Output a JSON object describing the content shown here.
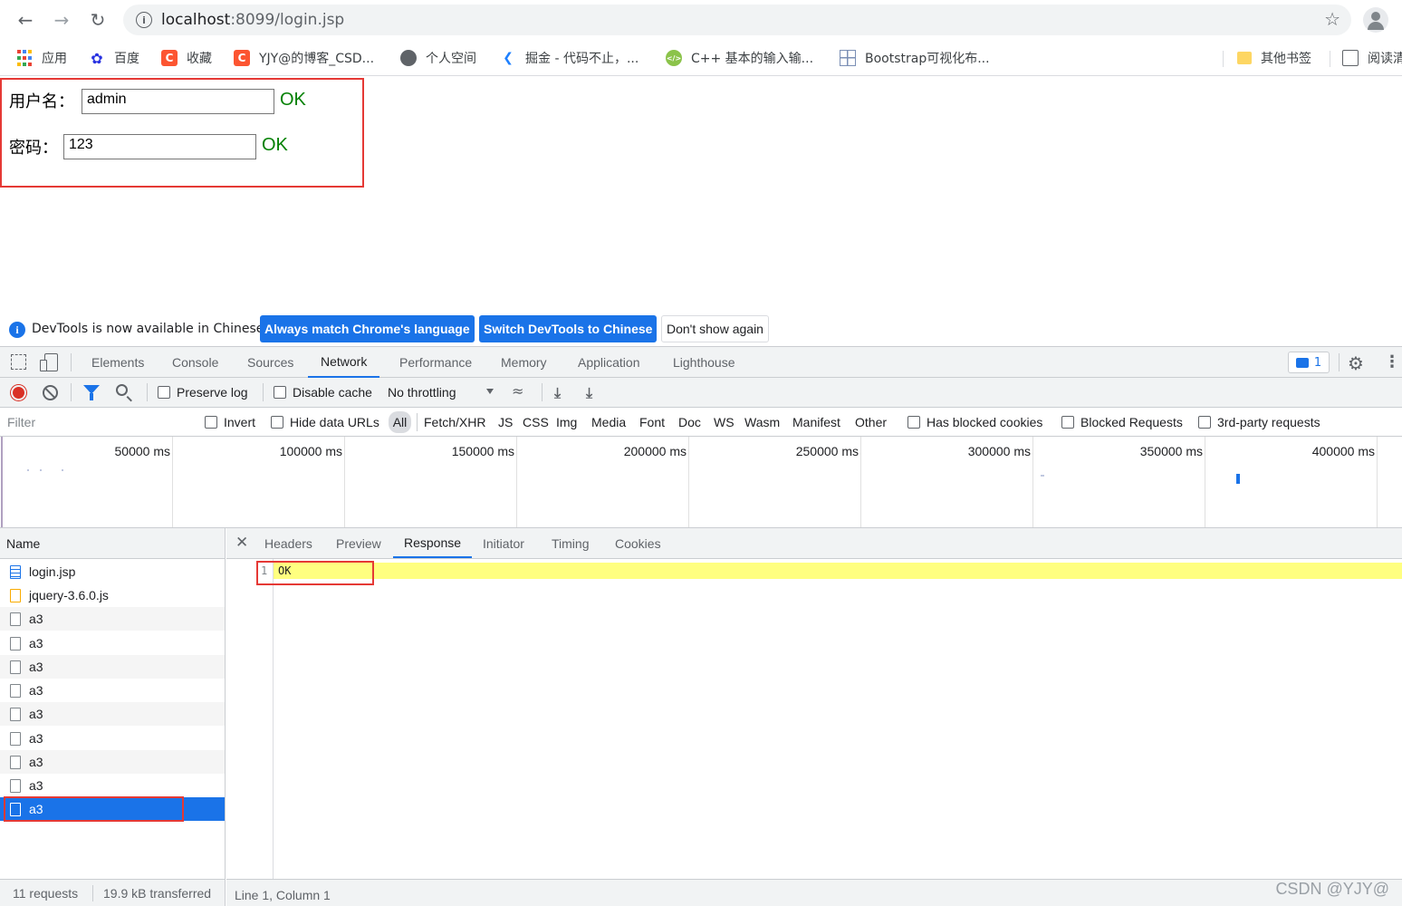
{
  "browser": {
    "url_host": "localhost",
    "url_rest": ":8099/login.jsp",
    "bookmarks": [
      {
        "label": "应用",
        "icon": "apps-grid-icon"
      },
      {
        "label": "百度",
        "icon": "baidu-paw-icon"
      },
      {
        "label": "收藏",
        "icon": "csdn-icon"
      },
      {
        "label": "YJY@的博客_CSD...",
        "icon": "csdn-icon"
      },
      {
        "label": "个人空间",
        "icon": "globe-icon"
      },
      {
        "label": "掘金 - 代码不止，...",
        "icon": "juejin-icon"
      },
      {
        "label": "C++ 基本的输入输...",
        "icon": "cpp-icon"
      },
      {
        "label": "Bootstrap可视化布...",
        "icon": "bootstrap-grid-icon"
      },
      {
        "label": "其他书签",
        "icon": "folder-icon"
      },
      {
        "label": "阅读清",
        "icon": "reading-list-icon"
      }
    ]
  },
  "page": {
    "username_label": "用户名：",
    "username_value": "admin",
    "username_status": "OK",
    "password_label": "密码：",
    "password_value": "123",
    "password_status": "OK"
  },
  "infobar": {
    "message": "DevTools is now available in Chinese!",
    "btn_match": "Always match Chrome's language",
    "btn_switch": "Switch DevTools to Chinese",
    "btn_dismiss": "Don't show again"
  },
  "devtools": {
    "tabs": [
      "Elements",
      "Console",
      "Sources",
      "Network",
      "Performance",
      "Memory",
      "Application",
      "Lighthouse"
    ],
    "active_tab": "Network",
    "issues_count": "1",
    "toolbar": {
      "preserve_log": "Preserve log",
      "disable_cache": "Disable cache",
      "throttling": "No throttling"
    },
    "filter": {
      "placeholder": "Filter",
      "invert": "Invert",
      "hide_data_urls": "Hide data URLs",
      "types": [
        "All",
        "Fetch/XHR",
        "JS",
        "CSS",
        "Img",
        "Media",
        "Font",
        "Doc",
        "WS",
        "Wasm",
        "Manifest",
        "Other"
      ],
      "has_blocked_cookies": "Has blocked cookies",
      "blocked_requests": "Blocked Requests",
      "third_party": "3rd-party requests"
    },
    "timeline_ticks": [
      "50000 ms",
      "100000 ms",
      "150000 ms",
      "200000 ms",
      "250000 ms",
      "300000 ms",
      "350000 ms",
      "400000 ms"
    ],
    "name_header": "Name",
    "requests": [
      {
        "name": "login.jsp",
        "type": "doc"
      },
      {
        "name": "jquery-3.6.0.js",
        "type": "js"
      },
      {
        "name": "a3",
        "type": "other"
      },
      {
        "name": "a3",
        "type": "other"
      },
      {
        "name": "a3",
        "type": "other"
      },
      {
        "name": "a3",
        "type": "other"
      },
      {
        "name": "a3",
        "type": "other"
      },
      {
        "name": "a3",
        "type": "other"
      },
      {
        "name": "a3",
        "type": "other"
      },
      {
        "name": "a3",
        "type": "other"
      },
      {
        "name": "a3",
        "type": "other",
        "selected": true
      }
    ],
    "detail_tabs": [
      "Headers",
      "Preview",
      "Response",
      "Initiator",
      "Timing",
      "Cookies"
    ],
    "active_detail_tab": "Response",
    "response_line_number": "1",
    "response_body": "OK",
    "status_requests": "11 requests",
    "status_transferred": "19.9 kB transferred",
    "cursor_position": "Line 1, Column 1"
  },
  "watermark": "CSDN @YJY@"
}
